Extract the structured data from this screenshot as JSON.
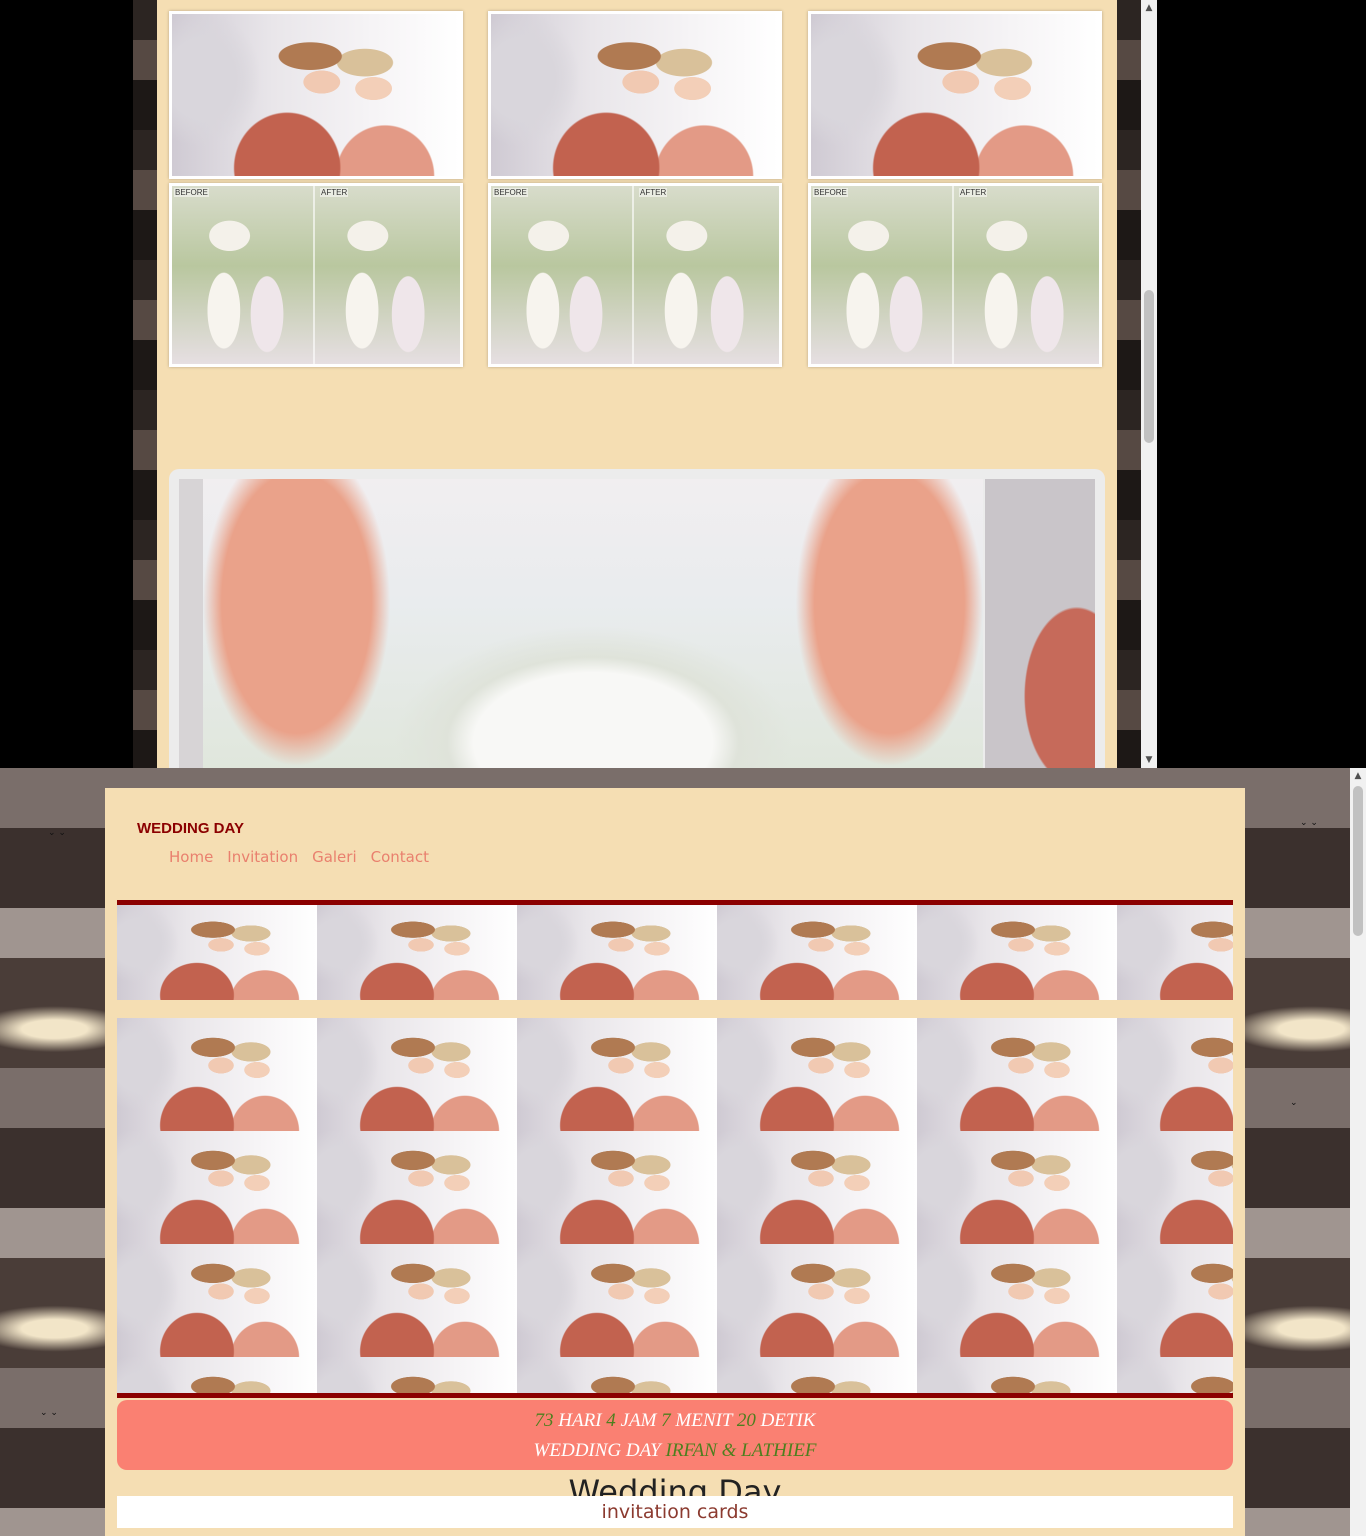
{
  "top_window": {
    "gallery_row1": [
      "couple",
      "couple",
      "couple"
    ],
    "gallery_row2": [
      {
        "before": "BEFORE",
        "after": "AFTER"
      },
      {
        "before": "BEFORE",
        "after": "AFTER"
      },
      {
        "before": "BEFORE",
        "after": "AFTER"
      }
    ]
  },
  "bottom_window": {
    "brand": "WEDDING DAY",
    "nav": {
      "home": "Home",
      "invitation": "Invitation",
      "galeri": "Galeri",
      "contact": "Contact"
    },
    "countdown": {
      "days": "73",
      "days_label": "HARI",
      "hours": "4",
      "hours_label": "JAM",
      "minutes": "7",
      "minutes_label": "MENIT",
      "seconds": "20",
      "seconds_label": "DETIK",
      "event_label": "WEDDING DAY",
      "names": "IRFAN & LATHIEF"
    },
    "section_title": "Wedding Day",
    "subtitle": "invitation cards"
  },
  "colors": {
    "page_bg": "#f5deb3",
    "brand": "#8b0000",
    "nav_link": "#e9806e",
    "countdown_bg": "#fa8072",
    "countdown_accent": "#4d7f1e"
  },
  "icons": [
    "scroll-up-arrow-icon",
    "scroll-down-arrow-icon"
  ]
}
